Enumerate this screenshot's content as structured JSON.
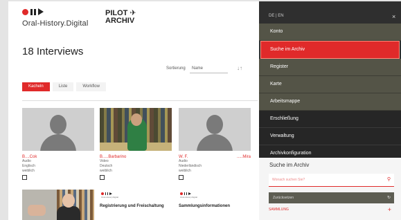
{
  "header": {
    "logo_text": "Oral-History.Digital",
    "pilot_line1": "PILOT",
    "pilot_line2": "ARCHIV"
  },
  "main": {
    "title": "18 Interviews",
    "sort_label": "Sortierung",
    "sort_value": "Name",
    "sort_dir_symbol": "↓↑",
    "tabs": [
      {
        "label": "Kacheln",
        "active": true
      },
      {
        "label": "Liste",
        "active": false
      },
      {
        "label": "Workflow",
        "active": false
      }
    ],
    "cards": [
      {
        "name": "B....Cok",
        "line1": "Audio",
        "line2": "Englisch",
        "line3": "weiblich"
      },
      {
        "name": "B.....Barbarino",
        "line1": "Video",
        "line2": "Deutsch",
        "line3": "weiblich"
      },
      {
        "name": "W. F.",
        "name_right": ".....Mira",
        "line1": "Audio",
        "line2": "Niederländisch",
        "line3": "weiblich"
      }
    ],
    "cards_row2": [
      {
        "title": "",
        "sub": ""
      },
      {
        "title": "Registrierung und Freischaltung",
        "sub": "Oral-History.Digital"
      },
      {
        "title": "Sammlungsinformationen",
        "sub": "Oral-History.Digital"
      }
    ]
  },
  "panel": {
    "lang": "DE | EN",
    "close_symbol": "×",
    "menu": [
      {
        "label": "Konto",
        "style": "normal"
      },
      {
        "label": "Suche im Archiv",
        "style": "active"
      },
      {
        "label": "Register",
        "style": "normal"
      },
      {
        "label": "Karte",
        "style": "normal"
      },
      {
        "label": "Arbeitsmappe",
        "style": "normal"
      },
      {
        "label": "Erschließung",
        "style": "dark"
      },
      {
        "label": "Verwaltung",
        "style": "dark"
      },
      {
        "label": "Archivkonfiguration",
        "style": "dark"
      }
    ],
    "search": {
      "title": "Suche im Archiv",
      "placeholder": "Wonach suchen Sie?",
      "reset_label": "Zurücksetzen",
      "collection_label": "SAMMLUNG"
    }
  },
  "colors": {
    "accent": "#e02a2a",
    "panel_bg": "#2f2f2f",
    "menu_bg": "#545447"
  }
}
